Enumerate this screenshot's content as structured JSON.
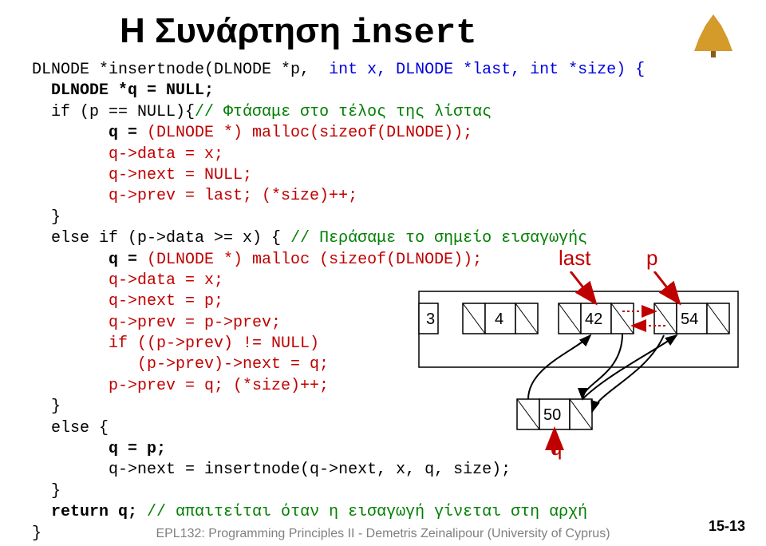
{
  "title_prefix": "Η Συνάρτηση ",
  "title_mono": "insert",
  "code": {
    "l01a": "DLNODE *insertnode(DLNODE *p,",
    "l01b": "  int x, DLNODE *last, int *size) {",
    "l02": "  DLNODE *q = NULL;",
    "l03a": "  if (p == NULL){",
    "l03b": "// Φτάσαμε στο τέλος της λίστας",
    "l04a": "        q = ",
    "l04b": "(DLNODE *) malloc(sizeof(DLNODE));",
    "l05": "        q->data = x;",
    "l06": "        q->next = NULL;",
    "l07": "        q->prev = last; (*size)++;",
    "l08": "  }",
    "l09a": "  else if (p->data >= x) { ",
    "l09b": "// Περάσαμε το σημείο εισαγωγής",
    "l10a": "        q = ",
    "l10b": "(DLNODE *) malloc (sizeof(DLNODE));",
    "l11": "        q->data = x;",
    "l12": "        q->next = p;",
    "l13": "        q->prev = p->prev;",
    "l14": "        if ((p->prev) != NULL)",
    "l15": "           (p->prev)->next = q;",
    "l16": "        p->prev = q; (*size)++;",
    "l17": "  }",
    "l18": "  else {",
    "l19": "        q = p;",
    "l20": "        q->next = insertnode(q->next, x, q, size);",
    "l21": "  }",
    "l22a": "  return q;",
    "l22b": " // απαιτείται όταν η εισαγωγή γίνεται στη αρχή",
    "l23": "}"
  },
  "labels": {
    "last": "last",
    "p": "p",
    "q": "q"
  },
  "node_values": {
    "a": "3",
    "b": "4",
    "c": "42",
    "d": "54",
    "new": "50"
  },
  "footer": "EPL132: Programming Principles II - Demetris Zeinalipour (University of Cyprus)",
  "pagenum": "15-13"
}
